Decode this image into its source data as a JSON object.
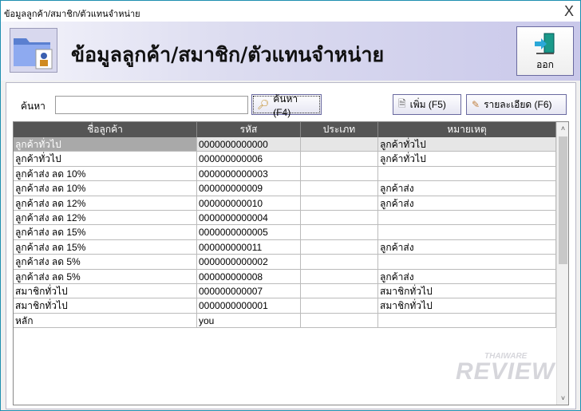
{
  "window": {
    "title": "ข้อมูลลูกค้า/สมาชิก/ตัวแทนจำหน่าย",
    "close": "X"
  },
  "header": {
    "title": "ข้อมูลลูกค้า/สมาชิก/ตัวแทนจำหน่าย",
    "exit_label": "ออก"
  },
  "search": {
    "label": "ค้นหา",
    "value": "",
    "search_button": "ค้นหา (F4)",
    "add_button": "เพิ่ม (F5)",
    "detail_button": "รายละเอียด (F6)"
  },
  "table": {
    "columns": [
      "ชื่อลูกค้า",
      "รหัส",
      "ประเภท",
      "หมายเหตุ"
    ],
    "rows": [
      [
        "ลูกค้าทั่วไป",
        "0000000000000",
        "",
        "ลูกค้าทั่วไป"
      ],
      [
        "ลูกค้าทั่วไป",
        "000000000006",
        "",
        "ลูกค้าทั่วไป"
      ],
      [
        "ลูกค้าส่ง ลด 10%",
        "0000000000003",
        "",
        ""
      ],
      [
        "ลูกค้าส่ง ลด 10%",
        "000000000009",
        "",
        "ลูกค้าส่ง"
      ],
      [
        "ลูกค้าส่ง ลด 12%",
        "000000000010",
        "",
        "ลูกค้าส่ง"
      ],
      [
        "ลูกค้าส่ง ลด 12%",
        "0000000000004",
        "",
        ""
      ],
      [
        "ลูกค้าส่ง ลด 15%",
        "0000000000005",
        "",
        ""
      ],
      [
        "ลูกค้าส่ง ลด 15%",
        "000000000011",
        "",
        "ลูกค้าส่ง"
      ],
      [
        "ลูกค้าส่ง ลด 5%",
        "0000000000002",
        "",
        ""
      ],
      [
        "ลูกค้าส่ง ลด 5%",
        "000000000008",
        "",
        "ลูกค้าส่ง"
      ],
      [
        "สมาชิกทั่วไป",
        "000000000007",
        "",
        "สมาชิกทั่วไป"
      ],
      [
        "สมาชิกทั่วไป",
        "0000000000001",
        "",
        "สมาชิกทั่วไป"
      ],
      [
        "หลัก",
        "you",
        "",
        ""
      ]
    ]
  },
  "watermark": {
    "top": "THAIWARE",
    "main": "REVIEW"
  }
}
